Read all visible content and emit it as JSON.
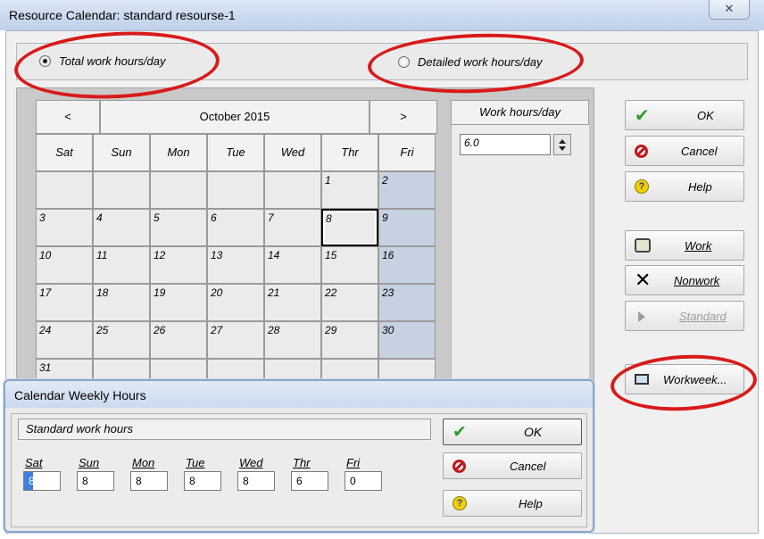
{
  "window": {
    "title": "Resource Calendar: standard resourse-1",
    "close_symbol": "✕"
  },
  "mode": {
    "option_total": "Total work hours/day",
    "option_detailed": "Detailed work hours/day",
    "selected": "total"
  },
  "calendar": {
    "prev": "<",
    "next": ">",
    "month": "October 2015",
    "days": [
      "Sat",
      "Sun",
      "Mon",
      "Tue",
      "Wed",
      "Thr",
      "Fri"
    ],
    "weeks": [
      [
        "",
        "",
        "",
        "",
        "",
        "1",
        "2"
      ],
      [
        "3",
        "4",
        "5",
        "6",
        "7",
        "8",
        "9"
      ],
      [
        "10",
        "11",
        "12",
        "13",
        "14",
        "15",
        "16"
      ],
      [
        "17",
        "18",
        "19",
        "20",
        "21",
        "22",
        "23"
      ],
      [
        "24",
        "25",
        "26",
        "27",
        "28",
        "29",
        "30"
      ],
      [
        "31",
        "",
        "",
        "",
        "",
        "",
        ""
      ]
    ],
    "selected_date": "8"
  },
  "hours": {
    "label": "Work hours/day",
    "value": "6.0"
  },
  "buttons": {
    "ok": "OK",
    "cancel": "Cancel",
    "help": "Help",
    "work": "Work",
    "nonwork": "Nonwork",
    "standard": "Standard",
    "workweek": "Workweek..."
  },
  "weekly_dialog": {
    "title": "Calendar Weekly Hours",
    "section": "Standard work hours",
    "days": [
      "Sat",
      "Sun",
      "Mon",
      "Tue",
      "Wed",
      "Thr",
      "Fri"
    ],
    "values": [
      "8",
      "8",
      "8",
      "8",
      "8",
      "6",
      "0"
    ],
    "ok": "OK",
    "cancel": "Cancel",
    "help": "Help"
  },
  "colors": {
    "annotation": "#d81a1a",
    "ok_check": "#2f9a2f",
    "cancel_icon": "#c0181c",
    "help_icon": "#f2d000"
  }
}
